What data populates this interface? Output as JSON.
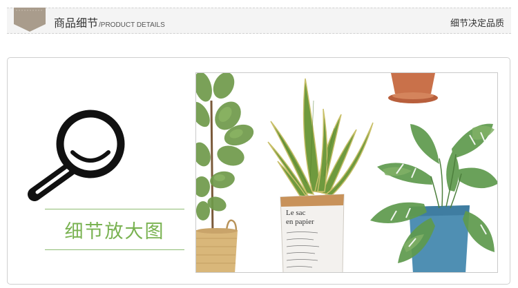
{
  "header": {
    "title_cn": "商品细节",
    "title_en": "/PRODUCT DETAILS",
    "slogan": "细节决定品质",
    "badge_icon": "pennant-badge-icon",
    "badge_color": "#a99c8c"
  },
  "detail_section": {
    "icon": "magnifier-icon",
    "label": "细节放大图",
    "accent_color": "#79b251"
  },
  "product_image": {
    "description_icon": "potted-plants-illustration",
    "bag_text": [
      "Le sac",
      "en papier"
    ]
  }
}
